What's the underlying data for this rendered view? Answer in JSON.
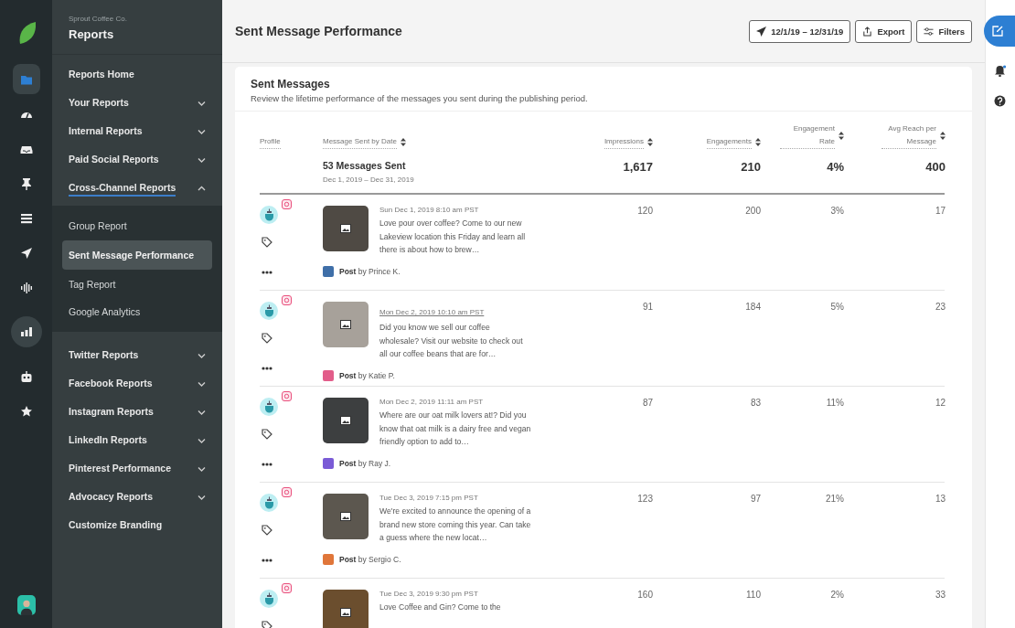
{
  "rail": {
    "items": [
      {
        "kind": "folder",
        "selected": true
      },
      {
        "kind": "gauge",
        "selected": false
      },
      {
        "kind": "inbox",
        "selected": false
      },
      {
        "kind": "pin",
        "selected": false
      },
      {
        "kind": "list",
        "selected": false
      },
      {
        "kind": "send",
        "selected": false
      },
      {
        "kind": "waveform",
        "selected": false
      },
      {
        "kind": "bars",
        "selected": true
      },
      {
        "kind": "bot",
        "selected": false
      },
      {
        "kind": "star",
        "selected": false
      }
    ]
  },
  "nav": {
    "org": "Sprout Coffee Co.",
    "title": "Reports",
    "items": [
      {
        "label": "Reports Home",
        "kind": "link"
      },
      {
        "label": "Your Reports",
        "kind": "group",
        "expanded": false
      },
      {
        "label": "Internal Reports",
        "kind": "group",
        "expanded": false
      },
      {
        "label": "Paid Social Reports",
        "kind": "group",
        "expanded": false
      },
      {
        "label": "Cross-Channel Reports",
        "kind": "group",
        "expanded": true,
        "children": [
          {
            "label": "Group Report",
            "selected": false
          },
          {
            "label": "Sent Message Performance",
            "selected": true
          },
          {
            "label": "Tag Report",
            "selected": false
          },
          {
            "label": "Google Analytics",
            "selected": false
          }
        ]
      },
      {
        "label": "Twitter Reports",
        "kind": "group",
        "expanded": false
      },
      {
        "label": "Facebook Reports",
        "kind": "group",
        "expanded": false
      },
      {
        "label": "Instagram Reports",
        "kind": "group",
        "expanded": false
      },
      {
        "label": "LinkedIn Reports",
        "kind": "group",
        "expanded": false
      },
      {
        "label": "Pinterest Performance",
        "kind": "group",
        "expanded": false
      },
      {
        "label": "Advocacy Reports",
        "kind": "group",
        "expanded": false
      },
      {
        "label": "Customize Branding",
        "kind": "link"
      }
    ]
  },
  "page": {
    "title": "Sent Message Performance",
    "date_range": "12/1/19 – 12/31/19",
    "export": "Export",
    "filters": "Filters"
  },
  "card": {
    "title": "Sent Messages",
    "subtitle": "Review the lifetime performance of the messages you sent during the publishing period.",
    "columns": [
      {
        "label": "Profile",
        "sortable": false
      },
      {
        "label": "Message Sent by Date",
        "sortable": true
      },
      {
        "label": "Impressions",
        "sortable": true
      },
      {
        "label": "Engagements",
        "sortable": true
      },
      {
        "label": "Engagement Rate",
        "sortable": true
      },
      {
        "label": "Avg Reach per Message",
        "sortable": true
      }
    ],
    "summary": {
      "count": "53 Messages Sent",
      "range": "Dec 1, 2019 – Dec 31, 2019",
      "impressions": "1,617",
      "engagements": "210",
      "rate": "4%",
      "reach": "400"
    },
    "rows": [
      {
        "date": "Sun Dec 1, 2019 8:10 am PST",
        "hovered": false,
        "text": "Love pour over coffee? Come to our new Lakeview location this Friday and learn all there is about how to brew…",
        "author": "**Post** by Prince K.",
        "color": "#3f6fa8",
        "impressions": "120",
        "engagements": "200",
        "rate": "3%",
        "reach": "17"
      },
      {
        "date": "Mon Dec 2, 2019 10:10 am PST",
        "hovered": true,
        "text": "Did you know we sell our coffee wholesale? Visit our website to check out all our coffee beans that are for…",
        "author": "**Post** by Katie P.",
        "color": "#e25d8a",
        "impressions": "91",
        "engagements": "184",
        "rate": "5%",
        "reach": "23"
      },
      {
        "date": "Mon Dec 2, 2019 11:11 am PST",
        "hovered": false,
        "text": "Where are our oat milk lovers at!? Did you know that oat milk is a dairy free and vegan friendly option to add to…",
        "author": "**Post** by Ray J.",
        "color": "#7a5bd6",
        "impressions": "87",
        "engagements": "83",
        "rate": "11%",
        "reach": "12"
      },
      {
        "date": "Tue Dec 3, 2019 7:15 pm PST",
        "hovered": false,
        "text": "We're excited to announce the opening of a brand new store coming this year. Can take a guess where the new locat…",
        "author": "**Post** by Sergio C.",
        "color": "#e0763a",
        "impressions": "123",
        "engagements": "97",
        "rate": "21%",
        "reach": "13"
      },
      {
        "date": "Tue Dec 3, 2019 9:30 pm PST",
        "hovered": false,
        "text": "Love Coffee and Gin? Come to the",
        "impressions": "160",
        "engagements": "110",
        "rate": "2%",
        "reach": "33"
      }
    ]
  }
}
